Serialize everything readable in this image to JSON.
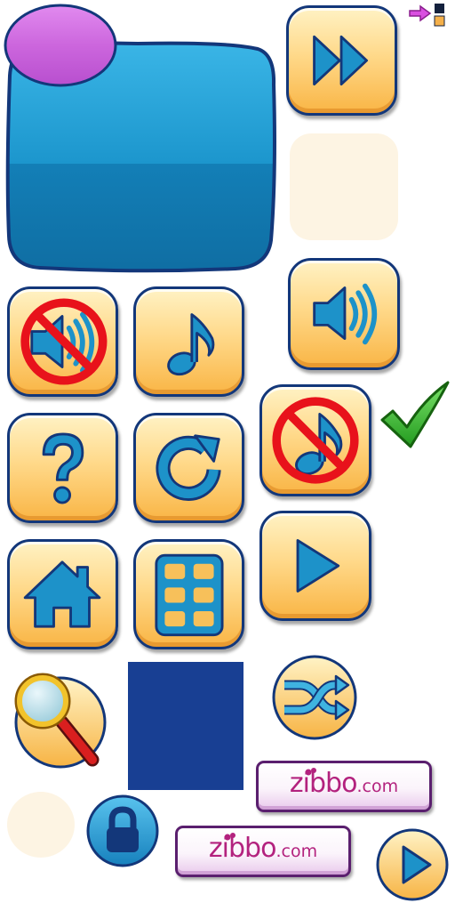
{
  "sprite_sheet": {
    "icons": [
      "arrow-right-icon",
      "fast-forward-icon",
      "sound-off-icon",
      "music-note-icon",
      "sound-on-icon",
      "help-icon",
      "restart-icon",
      "music-off-icon",
      "check-icon",
      "home-icon",
      "level-grid-icon",
      "play-icon",
      "magnifier-icon",
      "shuffle-icon",
      "lock-icon"
    ],
    "brand": {
      "name": "zibbo",
      "domain": ".com"
    },
    "colors": {
      "button_fill": "#ffd98a",
      "button_border": "#13377a",
      "icon_blue": "#1d92c9",
      "panel_blue": "#1d8fc4",
      "panel_badge": "#cc66dd",
      "navy_block": "#183f93",
      "check_green": "#33b52c",
      "prohibit_red": "#e8121b",
      "brand_magenta": "#b3227e"
    }
  }
}
